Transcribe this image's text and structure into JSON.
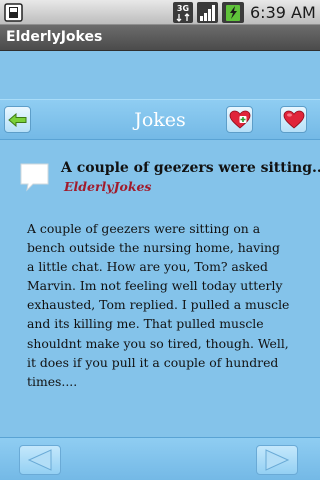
{
  "status_bar": {
    "time": "6:39 AM",
    "network": "3G",
    "icons": [
      "sd-card-icon",
      "network-3g-icon",
      "signal-icon",
      "battery-icon"
    ]
  },
  "app": {
    "title": "ElderlyJokes"
  },
  "header": {
    "title": "Jokes",
    "back_icon": "arrow-left-icon",
    "add_favorite_icon": "heart-plus-icon",
    "favorites_icon": "heart-icon"
  },
  "joke": {
    "icon": "speech-bubble-icon",
    "title": "A couple of geezers were sitting...",
    "source": "ElderlyJokes",
    "body": " A couple of geezers were sitting on a bench outside the nursing home, having a little chat. How are you, Tom? asked Marvin. Im not feeling well today utterly exhausted, Tom replied. I pulled a muscle and its killing me. That pulled muscle shouldnt make you so tired, though. Well, it does if you pull it a couple of hundred times...."
  },
  "footer": {
    "prev_icon": "triangle-left-icon",
    "next_icon": "triangle-right-icon"
  },
  "colors": {
    "background": "#84c3ea",
    "accent_red": "#a11b2b",
    "title_bar": "#5a5a5a"
  }
}
